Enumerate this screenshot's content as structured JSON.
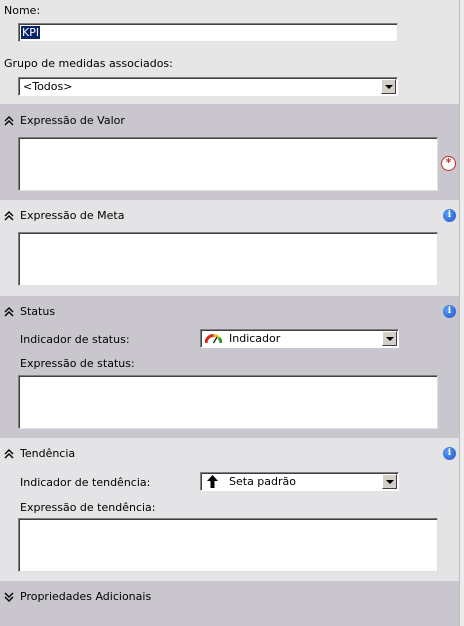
{
  "name_field": {
    "label": "Nome:",
    "value": "KPI"
  },
  "measure_group": {
    "label": "Grupo de medidas associados:",
    "value": "<Todos>"
  },
  "value_section": {
    "title": "Expressão de Valor",
    "expand_icon": "collapse-chevron-icon",
    "error_icon": "error-required-icon",
    "expression": ""
  },
  "goal_section": {
    "title": "Expressão de Meta",
    "info_icon": "info-icon",
    "expression": ""
  },
  "status_section": {
    "title": "Status",
    "info_icon": "info-icon",
    "indicator_label": "Indicador de status:",
    "indicator_value": "Indicador",
    "indicator_icon": "gauge-icon",
    "expression_label": "Expressão de status:",
    "expression": ""
  },
  "trend_section": {
    "title": "Tendência",
    "info_icon": "info-icon",
    "indicator_label": "Indicador de tendência:",
    "indicator_value": "Seta padrão",
    "indicator_icon": "arrow-up-icon",
    "expression_label": "Expressão de tendência:",
    "expression": ""
  },
  "additional_section": {
    "title": "Propriedades Adicionais",
    "expand_icon": "expand-chevron-icon"
  },
  "colors": {
    "panel_grey": "#c9c7cd",
    "panel_light": "#e4e3e6",
    "window": "#d4d0c8",
    "selection": "#0a246a",
    "info_blue": "#1f55c8",
    "error_red": "#c42b2b"
  }
}
